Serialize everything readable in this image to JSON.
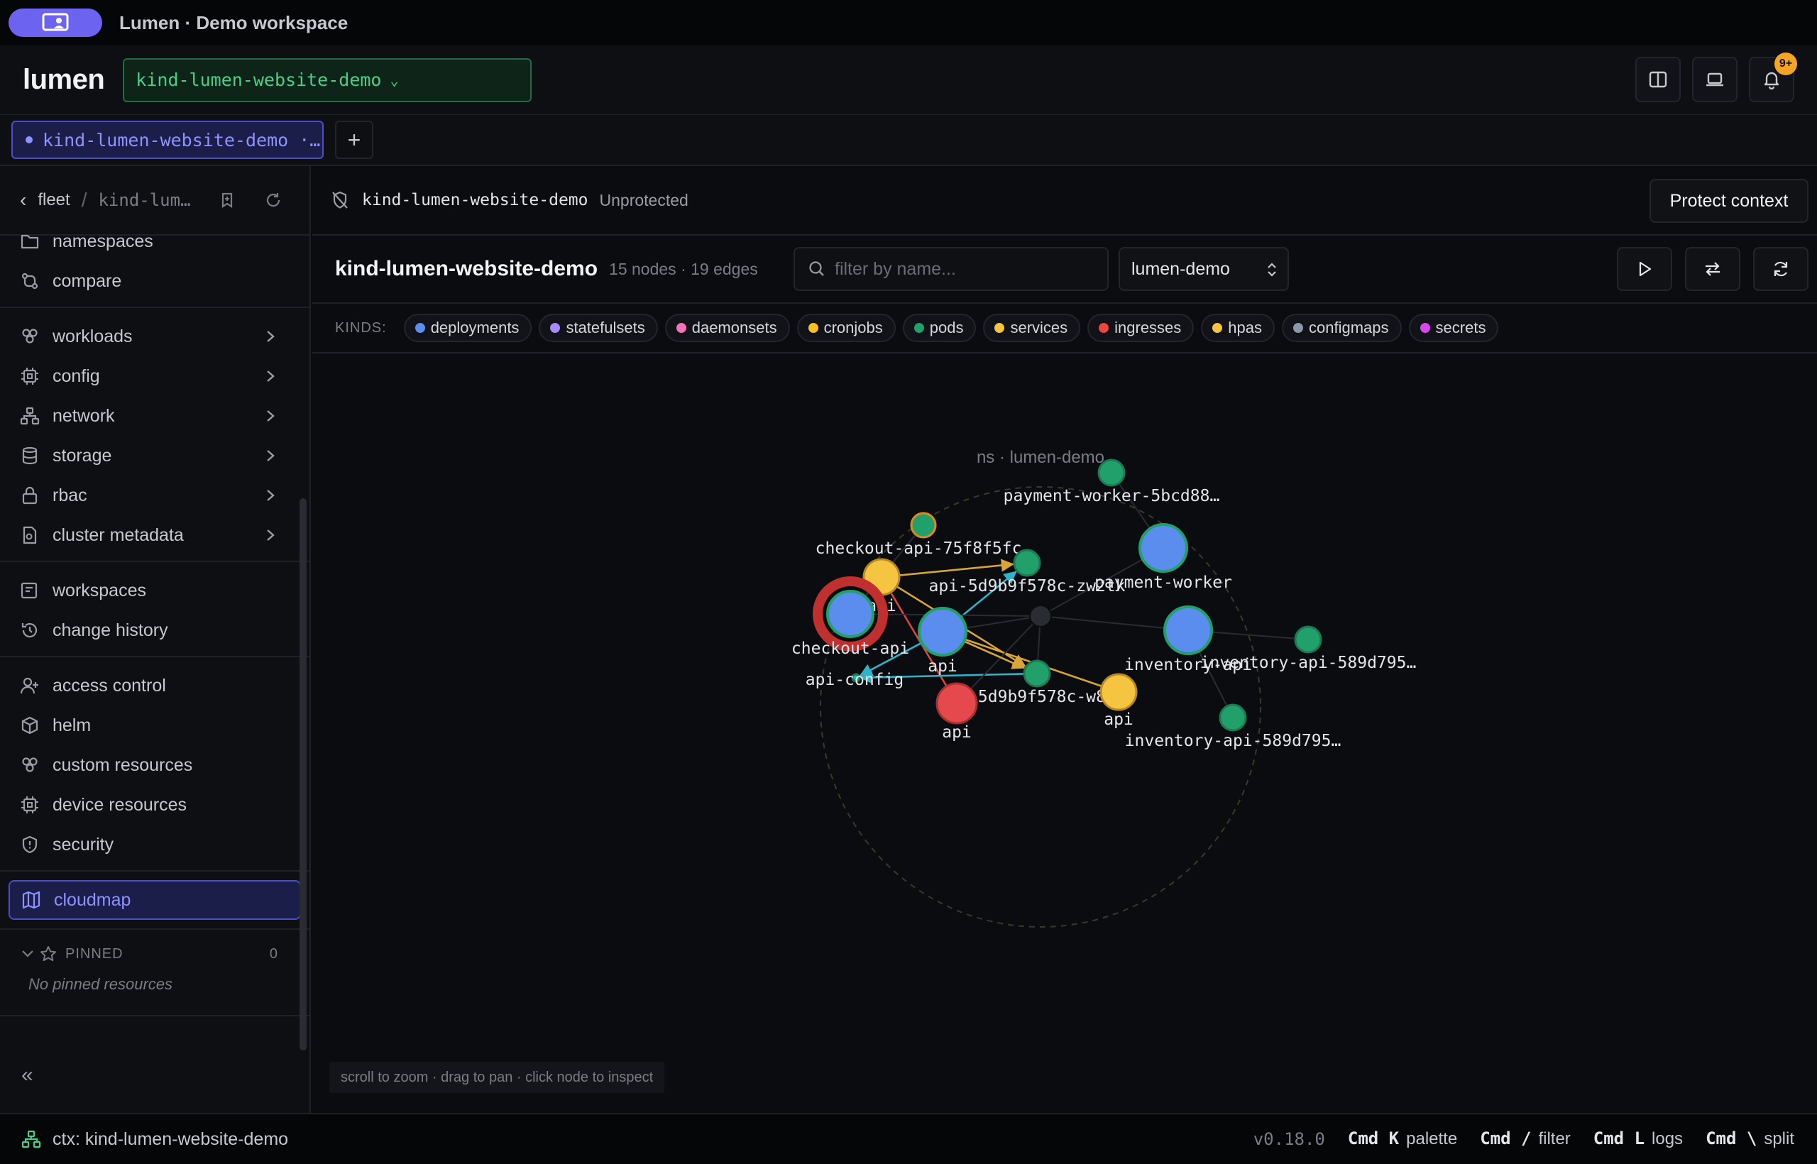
{
  "window": {
    "title": "Lumen · Demo workspace"
  },
  "header": {
    "brand": "lumen",
    "context_selector": "kind-lumen-website-demo",
    "notification_count": "9+"
  },
  "tabs": [
    {
      "label": "kind-lumen-website-demo ·…",
      "active": true
    }
  ],
  "tab_add_label": "+",
  "breadcrumb": {
    "root": "fleet",
    "separator": "/",
    "current": "kind-lum…"
  },
  "sidebar": {
    "sections": [
      [
        {
          "label": "namespaces",
          "icon": "folder-icon"
        },
        {
          "label": "compare",
          "icon": "compare-icon"
        }
      ],
      [
        {
          "label": "workloads",
          "icon": "workloads-icon",
          "expandable": true
        },
        {
          "label": "config",
          "icon": "chip-icon",
          "expandable": true
        },
        {
          "label": "network",
          "icon": "network-icon",
          "expandable": true
        },
        {
          "label": "storage",
          "icon": "database-icon",
          "expandable": true
        },
        {
          "label": "rbac",
          "icon": "lock-icon",
          "expandable": true
        },
        {
          "label": "cluster metadata",
          "icon": "metadata-icon",
          "expandable": true
        }
      ],
      [
        {
          "label": "workspaces",
          "icon": "workspaces-icon"
        },
        {
          "label": "change history",
          "icon": "history-icon"
        }
      ],
      [
        {
          "label": "access control",
          "icon": "user-plus-icon"
        },
        {
          "label": "helm",
          "icon": "package-icon"
        },
        {
          "label": "custom resources",
          "icon": "workloads-icon"
        },
        {
          "label": "device resources",
          "icon": "chip-icon"
        },
        {
          "label": "security",
          "icon": "shield-icon"
        }
      ]
    ],
    "active_item": {
      "label": "cloudmap",
      "icon": "map-icon"
    },
    "pinned": {
      "title": "PINNED",
      "count": "0",
      "empty_text": "No pinned resources"
    },
    "collapse_label": "«"
  },
  "context_bar": {
    "name": "kind-lumen-website-demo",
    "state": "Unprotected",
    "protect_button": "Protect context"
  },
  "graph_toolbar": {
    "title": "kind-lumen-website-demo",
    "stats": "15 nodes · 19 edges",
    "filter_placeholder": "filter by name...",
    "namespace": "lumen-demo"
  },
  "kinds": {
    "label": "KINDS:",
    "items": [
      {
        "label": "deployments",
        "color": "#5b8def"
      },
      {
        "label": "statefulsets",
        "color": "#a78bfa"
      },
      {
        "label": "daemonsets",
        "color": "#f472b6"
      },
      {
        "label": "cronjobs",
        "color": "#fbbf24"
      },
      {
        "label": "pods",
        "color": "#22a06b"
      },
      {
        "label": "services",
        "color": "#f5c542"
      },
      {
        "label": "ingresses",
        "color": "#ef4444"
      },
      {
        "label": "hpas",
        "color": "#f5c542"
      },
      {
        "label": "configmaps",
        "color": "#8b98a9"
      },
      {
        "label": "secrets",
        "color": "#d946ef"
      }
    ]
  },
  "graph": {
    "namespace_label": "ns · lumen-demo",
    "nodes": [
      {
        "id": "pw-pod",
        "label": "payment-worker-5bcd88…",
        "kind": "pods"
      },
      {
        "id": "co-pod",
        "label": "checkout-api-75f8f5fc…",
        "kind": "pods"
      },
      {
        "id": "api-svc",
        "label": "api",
        "kind": "services"
      },
      {
        "id": "api-pod1",
        "label": "api-5d9b9f578c-zw2tk",
        "kind": "pods"
      },
      {
        "id": "pw-dep",
        "label": "payment-worker",
        "kind": "deployments"
      },
      {
        "id": "co-dep",
        "label": "checkout-api",
        "kind": "deployments"
      },
      {
        "id": "api-dep",
        "label": "api",
        "kind": "deployments"
      },
      {
        "id": "inv-dep",
        "label": "inventory-api",
        "kind": "deployments"
      },
      {
        "id": "inv-pod1",
        "label": "inventory-api-589d795…",
        "kind": "pods"
      },
      {
        "id": "cfg",
        "label": "api-config",
        "kind": "configmaps"
      },
      {
        "id": "api-pod2",
        "label": "api-5d9b9f578c-w8b59",
        "kind": "pods"
      },
      {
        "id": "api-hpa",
        "label": "api",
        "kind": "hpas"
      },
      {
        "id": "api-ing",
        "label": "api",
        "kind": "ingresses"
      },
      {
        "id": "inv-pod2",
        "label": "inventory-api-589d795…",
        "kind": "pods"
      },
      {
        "id": "ns-hub",
        "label": "",
        "kind": "namespace"
      }
    ]
  },
  "canvas_hint": "scroll to zoom · drag to pan · click node to inspect",
  "statusbar": {
    "context": "ctx: kind-lumen-website-demo",
    "version": "v0.18.0",
    "shortcuts": [
      {
        "keys": "Cmd K",
        "action": "palette"
      },
      {
        "keys": "Cmd /",
        "action": "filter"
      },
      {
        "keys": "Cmd L",
        "action": "logs"
      },
      {
        "keys": "Cmd \\",
        "action": "split"
      }
    ]
  }
}
